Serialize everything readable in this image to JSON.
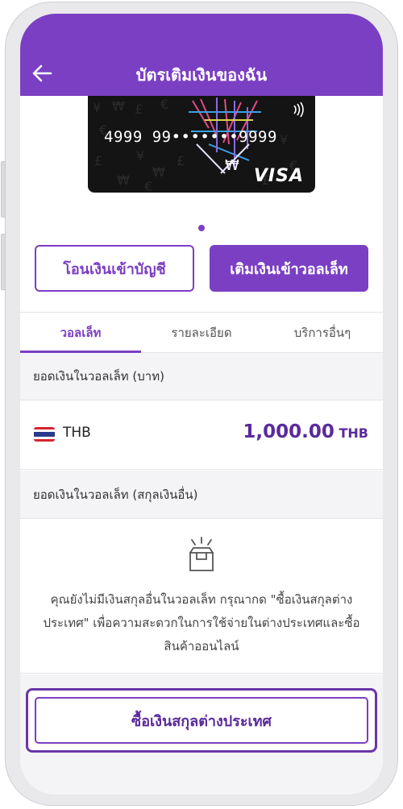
{
  "header": {
    "title": "บัตรเติมเงินของฉัน"
  },
  "card": {
    "number": "4999 99•••••••9999",
    "brand": "VISA"
  },
  "actions": {
    "transfer_label": "โอนเงินเข้าบัญชี",
    "topup_label": "เติมเงินเข้าวอลเล็ท"
  },
  "tabs": [
    {
      "label": "วอลเล็ท",
      "active": true
    },
    {
      "label": "รายละเอียด",
      "active": false
    },
    {
      "label": "บริการอื่นๆ",
      "active": false
    }
  ],
  "wallet_thb": {
    "heading": "ยอดเงินในวอลเล็ท (บาท)",
    "currency": "THB",
    "amount": "1,000.00",
    "amount_currency": "THB"
  },
  "wallet_foreign": {
    "heading": "ยอดเงินในวอลเล็ท (สกุลเงินอื่น)",
    "empty_message": "คุณยังไม่มีเงินสกุลอื่นในวอลเล็ท กรุณากด \"ซื้อเงินสกุลต่างประเทศ\" เพื่อความสะดวกในการใช้จ่ายในต่างประเทศและซื้อสินค้าออนไลน์"
  },
  "buy_button": {
    "label": "ซื้อเงินสกุลต่างประเทศ"
  },
  "colors": {
    "brand_purple": "#7b3fc4",
    "amount_purple": "#5a2a9c"
  }
}
